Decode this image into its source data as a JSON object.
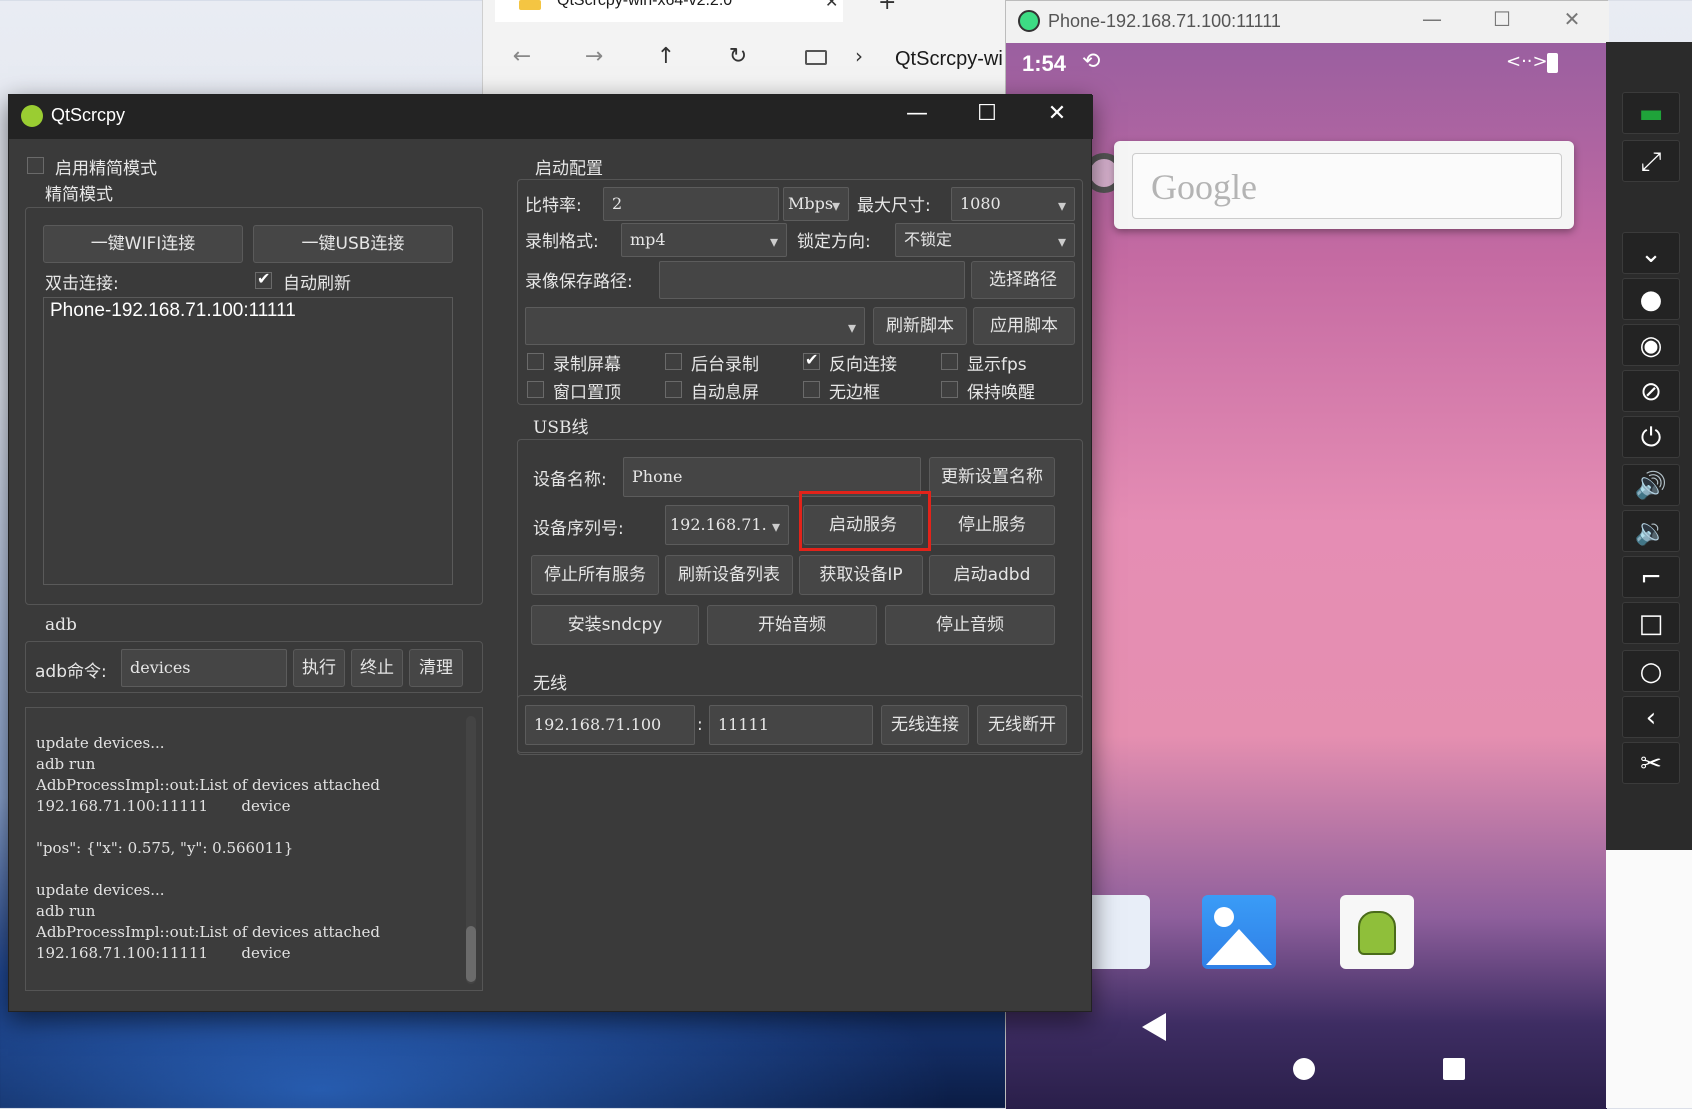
{
  "explorer": {
    "tab_title": "QtScrcpy-win-x64-v2.2.0",
    "tab_close": "✕",
    "new_tab": "+",
    "nav_back": "←",
    "nav_forward": "→",
    "nav_up": "↑",
    "nav_refresh": "↻",
    "breadcrumb_sep": "›",
    "breadcrumb_text": "QtScrcpy-wi"
  },
  "phone_window": {
    "title": "Phone-192.168.71.100:11111",
    "controls": {
      "minimize": "—",
      "maximize": "☐",
      "close": "✕"
    },
    "status": {
      "time": "1:54",
      "sync_icon": "⟲",
      "signal_icon": "<··>"
    },
    "search_label": "Google",
    "apps": [
      "contacts-icon",
      "gallery-icon",
      "android-icon"
    ]
  },
  "toolbar": {
    "buttons": [
      {
        "name": "menu-icon",
        "glyph": "▬"
      },
      {
        "name": "fullscreen-icon",
        "glyph": "⤢"
      },
      {
        "name": "expand-down-icon",
        "glyph": "⌄"
      },
      {
        "name": "record-icon",
        "glyph": "●"
      },
      {
        "name": "eye-icon",
        "glyph": "◉"
      },
      {
        "name": "eye-off-icon",
        "glyph": "⊘"
      },
      {
        "name": "power-icon",
        "glyph": "⏻"
      },
      {
        "name": "volume-up-icon",
        "glyph": "🔊"
      },
      {
        "name": "volume-down-icon",
        "glyph": "🔉"
      },
      {
        "name": "app-switch-icon",
        "glyph": "⌐"
      },
      {
        "name": "square-icon",
        "glyph": "□"
      },
      {
        "name": "circle-icon",
        "glyph": "○"
      },
      {
        "name": "back-icon",
        "glyph": "‹"
      },
      {
        "name": "scissors-icon",
        "glyph": "✂"
      }
    ],
    "accent_color": "#1fa33a"
  },
  "qt": {
    "title": "QtScrcpy",
    "controls": {
      "minimize": "—",
      "maximize": "☐",
      "close": "✕"
    },
    "simple_mode_checkbox": "启用精简模式",
    "simple_mode_group": "精简模式",
    "wifi_connect": "一键WIFI连接",
    "usb_connect": "一键USB连接",
    "double_click_label": "双击连接:",
    "auto_refresh": "自动刷新",
    "device_list": [
      "Phone-192.168.71.100:11111"
    ],
    "adb_group": "adb",
    "adb_cmd_label": "adb命令:",
    "adb_cmd_value": "devices",
    "btn_execute": "执行",
    "btn_terminate": "终止",
    "btn_clear": "清理",
    "log_lines": [
      "update devices...",
      "adb run",
      "AdbProcessImpl::out:List of devices attached",
      "192.168.71.100:11111       device",
      "",
      "\"pos\": {\"x\": 0.575, \"y\": 0.566011}",
      "",
      "update devices...",
      "adb run",
      "AdbProcessImpl::out:List of devices attached",
      "192.168.71.100:11111       device"
    ],
    "config_group": "启动配置",
    "bitrate_label": "比特率:",
    "bitrate_value": "2",
    "bitrate_unit": "Mbps",
    "max_size_label": "最大尺寸:",
    "max_size_value": "1080",
    "record_format_label": "录制格式:",
    "record_format_value": "mp4",
    "lock_orientation_label": "锁定方向:",
    "lock_orientation_value": "不锁定",
    "record_path_label": "录像保存路径:",
    "record_path_value": "",
    "select_path": "选择路径",
    "script_value": "",
    "refresh_script": "刷新脚本",
    "apply_script": "应用脚本",
    "options": [
      {
        "label": "录制屏幕",
        "checked": false
      },
      {
        "label": "后台录制",
        "checked": false
      },
      {
        "label": "反向连接",
        "checked": true
      },
      {
        "label": "显示fps",
        "checked": false
      },
      {
        "label": "窗口置顶",
        "checked": false
      },
      {
        "label": "自动息屏",
        "checked": false
      },
      {
        "label": "无边框",
        "checked": false
      },
      {
        "label": "保持唤醒",
        "checked": false
      }
    ],
    "usb_group": "USB线",
    "device_name_label": "设备名称:",
    "device_name_value": "Phone",
    "update_name": "更新设置名称",
    "serial_label": "设备序列号:",
    "serial_value": "192.168.71.",
    "start_service": "启动服务",
    "stop_service": "停止服务",
    "stop_all_services": "停止所有服务",
    "refresh_devices": "刷新设备列表",
    "get_device_ip": "获取设备IP",
    "start_adbd": "启动adbd",
    "install_sndcpy": "安装sndcpy",
    "start_audio": "开始音频",
    "stop_audio": "停止音频",
    "wireless_group": "无线",
    "wireless_ip": "192.168.71.100",
    "wireless_sep": ":",
    "wireless_port": "11111",
    "wireless_connect": "无线连接",
    "wireless_disconnect": "无线断开",
    "highlight_color": "#e2231a"
  }
}
